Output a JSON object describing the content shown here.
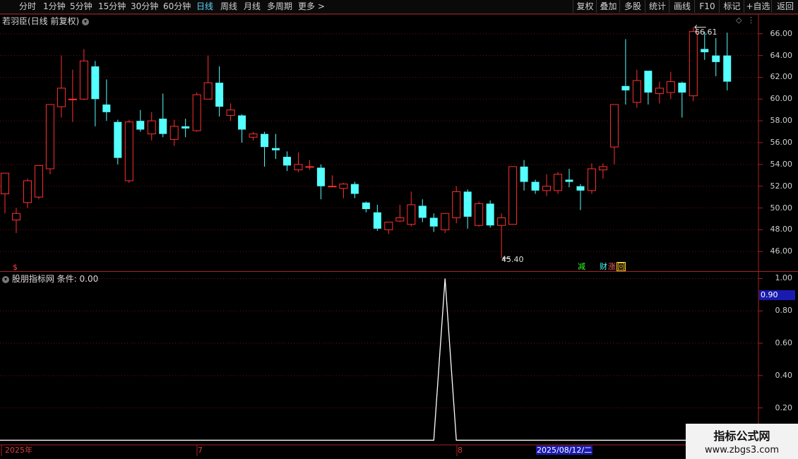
{
  "toolbar": {
    "periods": [
      "分时",
      "1分钟",
      "5分钟",
      "15分钟",
      "30分钟",
      "60分钟",
      "日线",
      "周线",
      "月线",
      "多周期",
      "更多"
    ],
    "active_period": "日线",
    "right_buttons": [
      "复权",
      "叠加",
      "多股",
      "统计",
      "画线",
      "F10",
      "标记",
      "+自选",
      "返回"
    ]
  },
  "main_panel": {
    "title": "若羽臣(日线 前复权)",
    "high_label": "66.61",
    "low_label": "45.40",
    "dollar_mark": "$",
    "tags": {
      "jian": "减",
      "cai": "财",
      "zhang": "涨",
      "hui": "回"
    }
  },
  "indicator_panel": {
    "title": "股朋指标网",
    "cond_label": "条件: 0.00",
    "highlight_value": "0.90"
  },
  "date_axis": {
    "labels": [
      "2025年",
      "7",
      "8"
    ],
    "highlight": "2025/08/12/二"
  },
  "watermark": {
    "line1": "指标公式网",
    "line2": "www.zbgs3.com"
  },
  "colors": {
    "up": "#ff3030",
    "down": "#54ffff",
    "grid": "#7a1010",
    "border": "#aa2020",
    "line": "#ffffff"
  },
  "chart_data": [
    {
      "type": "candlestick",
      "title": "若羽臣(日线 前复权)",
      "y_ticks": [
        46.0,
        48.0,
        50.0,
        52.0,
        54.0,
        56.0,
        58.0,
        60.0,
        62.0,
        64.0,
        66.0
      ],
      "ylim": [
        44.2,
        67.8
      ],
      "candles": [
        [
          51.3,
          53.2,
          49.5,
          51.2
        ],
        [
          48.9,
          49.5,
          47.7,
          50.0
        ],
        [
          50.5,
          52.5,
          50.0,
          52.7
        ],
        [
          51.0,
          53.9,
          50.8,
          53.9
        ],
        [
          53.6,
          59.5,
          53.1,
          59.5
        ],
        [
          59.3,
          61.0,
          58.3,
          64.0
        ],
        [
          60.0,
          60.0,
          57.9,
          62.7
        ],
        [
          60.0,
          63.5,
          59.9,
          64.6
        ],
        [
          63.0,
          60.0,
          57.5,
          63.5
        ],
        [
          59.5,
          58.8,
          58.0,
          61.8
        ],
        [
          57.9,
          54.6,
          54.0,
          58.1
        ],
        [
          52.5,
          57.9,
          52.3,
          58.1
        ],
        [
          58.0,
          57.2,
          57.0,
          59.0
        ],
        [
          56.8,
          58.0,
          56.2,
          58.8
        ],
        [
          58.2,
          56.8,
          56.5,
          60.5
        ],
        [
          56.3,
          57.5,
          55.7,
          58.1
        ],
        [
          57.5,
          57.3,
          56.5,
          58.2
        ],
        [
          57.1,
          60.4,
          57.0,
          60.6
        ],
        [
          60.0,
          61.5,
          60.0,
          64.0
        ],
        [
          61.5,
          59.3,
          58.4,
          63.0
        ],
        [
          58.5,
          59.0,
          58.0,
          59.6
        ],
        [
          58.5,
          57.2,
          56.0,
          58.6
        ],
        [
          56.5,
          56.8,
          56.2,
          57.0
        ],
        [
          56.8,
          55.6,
          53.8,
          57.0
        ],
        [
          55.5,
          55.3,
          54.5,
          56.8
        ],
        [
          54.7,
          53.9,
          53.4,
          55.2
        ],
        [
          53.5,
          54.0,
          53.3,
          55.1
        ],
        [
          53.8,
          53.8,
          53.5,
          54.4
        ],
        [
          53.7,
          52.0,
          50.8,
          54.0
        ],
        [
          52.0,
          52.0,
          51.9,
          53.0
        ],
        [
          51.8,
          52.2,
          50.9,
          52.3
        ],
        [
          52.2,
          51.3,
          50.9,
          52.4
        ],
        [
          50.5,
          49.9,
          49.6,
          50.6
        ],
        [
          49.6,
          48.1,
          47.9,
          50.3
        ],
        [
          48.0,
          48.7,
          47.6,
          48.7
        ],
        [
          48.8,
          49.1,
          48.7,
          50.3
        ],
        [
          48.5,
          50.3,
          48.3,
          51.5
        ],
        [
          50.2,
          49.1,
          48.7,
          50.8
        ],
        [
          49.1,
          48.3,
          47.8,
          49.5
        ],
        [
          48.0,
          49.5,
          47.7,
          49.5
        ],
        [
          49.1,
          51.5,
          48.6,
          52.0
        ],
        [
          51.5,
          49.2,
          48.1,
          51.7
        ],
        [
          48.4,
          50.4,
          48.3,
          50.6
        ],
        [
          50.4,
          48.4,
          48.2,
          50.7
        ],
        [
          48.4,
          49.1,
          45.4,
          49.5
        ],
        [
          48.5,
          53.8,
          48.5,
          53.8
        ],
        [
          53.8,
          52.4,
          51.6,
          54.4
        ],
        [
          52.4,
          51.6,
          51.3,
          52.6
        ],
        [
          51.6,
          52.0,
          51.1,
          53.1
        ],
        [
          51.6,
          53.1,
          51.3,
          53.3
        ],
        [
          52.6,
          52.4,
          51.9,
          53.6
        ],
        [
          52.0,
          51.6,
          49.8,
          52.2
        ],
        [
          51.6,
          53.6,
          51.3,
          54.1
        ],
        [
          53.5,
          53.8,
          52.7,
          54.1
        ],
        [
          55.6,
          59.5,
          54.0,
          59.5
        ],
        [
          61.2,
          60.8,
          59.5,
          65.5
        ],
        [
          59.7,
          61.7,
          59.2,
          62.7
        ],
        [
          62.6,
          60.6,
          59.5,
          62.6
        ],
        [
          60.5,
          61.0,
          59.6,
          61.6
        ],
        [
          60.6,
          61.6,
          60.0,
          62.5
        ],
        [
          61.5,
          60.6,
          58.3,
          61.6
        ],
        [
          60.3,
          66.2,
          59.8,
          66.6
        ],
        [
          64.6,
          64.3,
          63.6,
          66.2
        ],
        [
          64.0,
          63.4,
          62.1,
          65.6
        ],
        [
          64.0,
          61.6,
          60.8,
          66.1
        ]
      ]
    },
    {
      "type": "line",
      "title": "股朋指标网",
      "y_ticks": [
        0.2,
        0.4,
        0.6,
        0.8,
        1.0
      ],
      "ylim": [
        -0.02,
        1.05
      ],
      "series": [
        {
          "values": [
            0,
            0,
            0,
            0,
            0,
            0,
            0,
            0,
            0,
            0,
            0,
            0,
            0,
            0,
            0,
            0,
            0,
            0,
            0,
            0,
            0,
            0,
            0,
            0,
            0,
            0,
            0,
            0,
            0,
            0,
            0,
            0,
            0,
            0,
            0,
            0,
            0,
            0,
            0,
            1,
            0,
            0,
            0,
            0,
            0,
            0,
            0,
            0,
            0,
            0,
            0,
            0,
            0,
            0,
            0,
            0,
            0,
            0,
            0,
            0,
            0,
            0,
            0,
            0,
            0
          ]
        }
      ]
    }
  ]
}
